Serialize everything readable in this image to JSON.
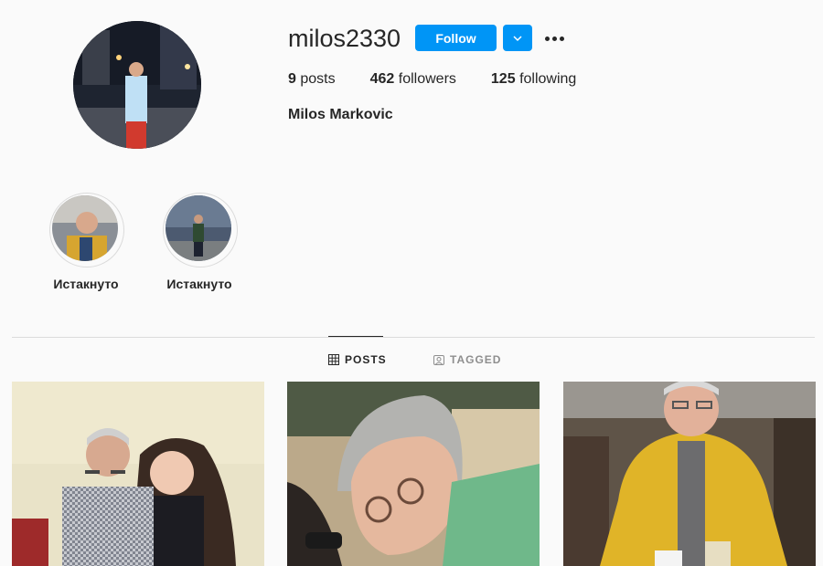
{
  "profile": {
    "username": "milos2330",
    "full_name": "Milos Markovic",
    "follow_label": "Follow"
  },
  "stats": {
    "posts_count": "9",
    "posts_label": "posts",
    "followers_count": "462",
    "followers_label": "followers",
    "following_count": "125",
    "following_label": "following"
  },
  "highlights": [
    {
      "label": "Истакнуто"
    },
    {
      "label": "Истакнуто"
    }
  ],
  "tabs": {
    "posts": "POSTS",
    "tagged": "TAGGED"
  },
  "colors": {
    "accent": "#0095f6",
    "text": "#262626",
    "muted": "#8e8e8e",
    "border": "#dbdbdb",
    "background": "#fafafa"
  }
}
